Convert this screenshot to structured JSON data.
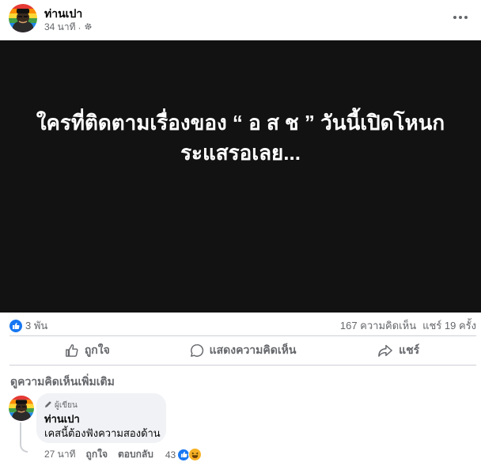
{
  "post": {
    "author": "ท่านเปา",
    "time": "34 นาที",
    "separator": "·",
    "privacy_icon": "gear-icon",
    "more_icon": "more-horizontal-icon",
    "text_line1": "ใครที่ติดตามเรื่องของ “ อ ส ช ” วันนี้เปิดโหนก",
    "text_line2": "ระแสรอเลย..."
  },
  "stats": {
    "likes": "3 พัน",
    "comments": "167 ความคิดเห็น",
    "shares": "แชร์ 19 ครั้ง"
  },
  "actions": {
    "like": "ถูกใจ",
    "comment": "แสดงความคิดเห็น",
    "share": "แชร์"
  },
  "more_comments": "ดูความคิดเห็นเพิ่มเติม",
  "comment": {
    "badge": "ผู้เขียน",
    "author": "ท่านเปา",
    "text": "เคสนี้ต้องฟังความสองด้าน",
    "time": "27 นาที",
    "like": "ถูกใจ",
    "reply": "ตอบกลับ",
    "reaction_count": "43"
  },
  "colors": {
    "accent": "#1877f2",
    "media_bg": "#121212",
    "muted": "#65676b",
    "bubble": "#f0f2f5"
  }
}
